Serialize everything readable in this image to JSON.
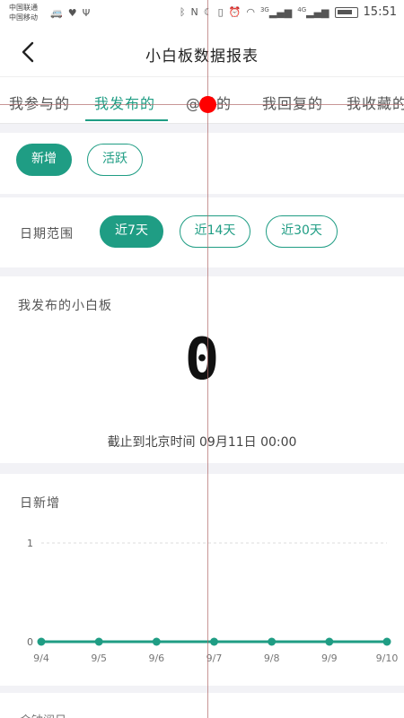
{
  "status_bar": {
    "carrier1": "中国联通",
    "carrier2": "中国移动",
    "left_icons": [
      "car-icon",
      "heart-icon",
      "usb-icon"
    ],
    "right_icons": [
      "bluetooth-icon",
      "nfc-icon",
      "moon-icon",
      "vibrate-icon",
      "alarm-icon",
      "wifi-icon",
      "signal-3g-icon",
      "signal-4g-icon",
      "battery-icon"
    ],
    "net1": "3G",
    "net2": "4G",
    "time": "15:51"
  },
  "nav": {
    "back_icon": "back-arrow-icon",
    "title": "小白板数据报表"
  },
  "tabs": [
    {
      "label": "我参与的",
      "active": false
    },
    {
      "label": "我发布的",
      "active": true
    },
    {
      "label": "@我的",
      "active": false
    },
    {
      "label": "我回复的",
      "active": false
    },
    {
      "label": "我收藏的",
      "active": false
    }
  ],
  "type_filter": {
    "options": [
      {
        "label": "新增",
        "active": true
      },
      {
        "label": "活跃",
        "active": false
      }
    ]
  },
  "date_range": {
    "label": "日期范围",
    "options": [
      {
        "label": "近7天",
        "active": true
      },
      {
        "label": "近14天",
        "active": false
      },
      {
        "label": "近30天",
        "active": false
      }
    ]
  },
  "published": {
    "title": "我发布的小白板",
    "count": "0",
    "footer": "截止到北京时间 09月11日 00:00"
  },
  "daily_new": {
    "title": "日新增"
  },
  "chart_data": {
    "type": "line",
    "title": "日新增",
    "x": [
      "9/4",
      "9/5",
      "9/6",
      "9/7",
      "9/8",
      "9/9",
      "9/10"
    ],
    "series": [
      {
        "values": [
          0,
          0,
          0,
          0,
          0,
          0,
          0
        ]
      }
    ],
    "yticks": [
      0,
      1
    ],
    "ylim": [
      0,
      1
    ],
    "color": "#1f9d84"
  },
  "next_section": {
    "title": "金钟阅日"
  },
  "colors": {
    "accent": "#1f9d84",
    "overlay_dot": "#ff0000"
  }
}
